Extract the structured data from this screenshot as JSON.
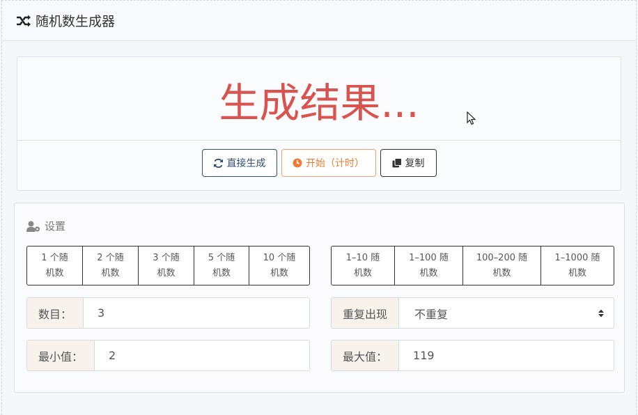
{
  "header": {
    "title": "随机数生成器",
    "icon": "shuffle-icon"
  },
  "result": {
    "text": "生成结果...",
    "color": "#d9534f",
    "buttons": {
      "direct": {
        "label": "直接生成",
        "icon": "refresh-icon"
      },
      "start": {
        "label": "开始（计时）",
        "icon": "clock-icon"
      },
      "copy": {
        "label": "复制",
        "icon": "copy-icon"
      }
    }
  },
  "settings": {
    "title": "设置",
    "icon": "user-gear-icon",
    "count_presets": [
      {
        "line1": "1 个随",
        "line2": "机数"
      },
      {
        "line1": "2 个随",
        "line2": "机数"
      },
      {
        "line1": "3 个随",
        "line2": "机数"
      },
      {
        "line1": "5 个随",
        "line2": "机数"
      },
      {
        "line1": "10 个随",
        "line2": "机数"
      }
    ],
    "range_presets": [
      {
        "line1": "1–10 随",
        "line2": "机数"
      },
      {
        "line1": "1–100 随",
        "line2": "机数"
      },
      {
        "line1": "100–200 随",
        "line2": "机数"
      },
      {
        "line1": "1–1000 随",
        "line2": "机数"
      }
    ],
    "count": {
      "label": "数目：",
      "value": "3"
    },
    "repeat": {
      "label": "重复出现",
      "value": "不重复"
    },
    "min": {
      "label": "最小值：",
      "value": "2"
    },
    "max": {
      "label": "最大值：",
      "value": "119"
    }
  }
}
